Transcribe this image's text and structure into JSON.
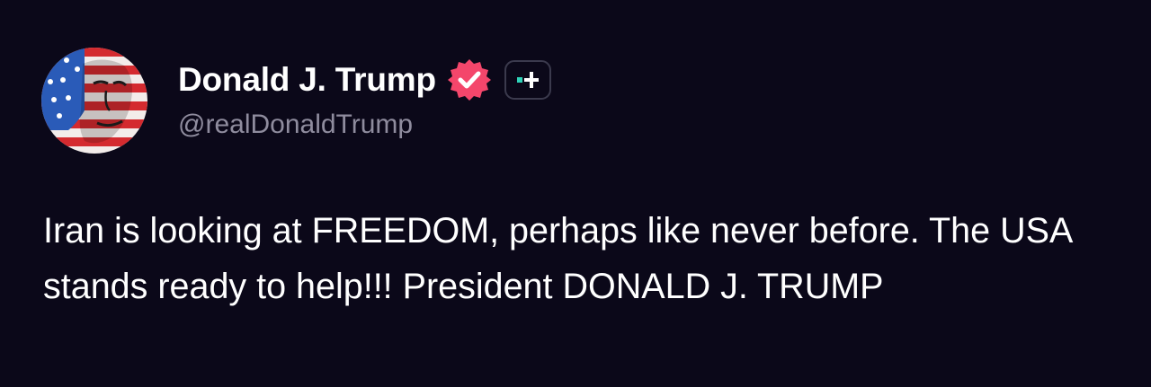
{
  "author": {
    "display_name": "Donald J. Trump",
    "handle": "@realDonaldTrump",
    "avatar_icon": "flag-portrait-avatar",
    "verified_icon": "verified-check-icon",
    "plus_icon": "plus-badge-icon"
  },
  "post": {
    "text": "Iran is looking at FREEDOM, perhaps like never before. The USA stands ready to help!!! President DONALD J. TRUMP"
  },
  "colors": {
    "background": "#0b0819",
    "text": "#ffffff",
    "handle": "#8f8c9e",
    "verified_badge": "#f4466b",
    "plus_accent": "#2fd3b8"
  }
}
